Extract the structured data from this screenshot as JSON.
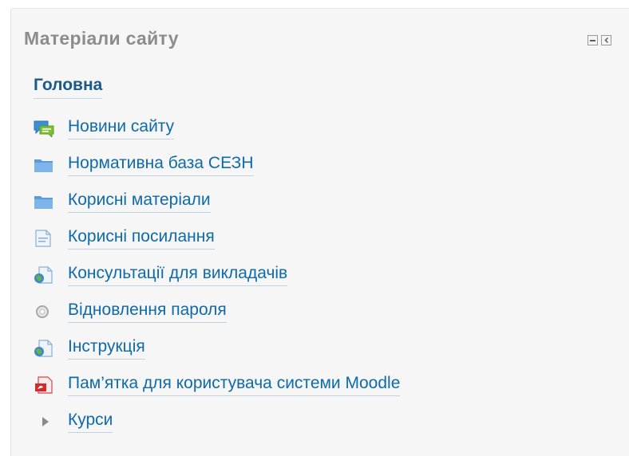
{
  "block": {
    "title": "Матеріали сайту",
    "controls": {
      "hide_icon": "minus-box-icon",
      "dock_icon": "dock-left-icon"
    }
  },
  "nav": {
    "home": "Головна",
    "items": [
      {
        "label": "Новини сайту",
        "icon": "forum-icon"
      },
      {
        "label": "Нормативна база СЕЗН",
        "icon": "folder-icon"
      },
      {
        "label": "Корисні матеріали",
        "icon": "folder-icon"
      },
      {
        "label": "Корисні посилання",
        "icon": "page-icon"
      },
      {
        "label": "Консультації для викладачів",
        "icon": "url-icon"
      },
      {
        "label": "Відновлення пароля",
        "icon": "search-icon"
      },
      {
        "label": "Інструкція",
        "icon": "url-icon"
      },
      {
        "label": "Пам’ятка для користувача системи Moodle",
        "icon": "pdf-icon"
      },
      {
        "label": "Курси",
        "icon": "collapsed-arrow-icon"
      }
    ]
  },
  "colors": {
    "title": "#8c8c8c",
    "home_link": "#1a5b8a",
    "link": "#0f6aa8",
    "block_bg": "#f6f6f6"
  }
}
